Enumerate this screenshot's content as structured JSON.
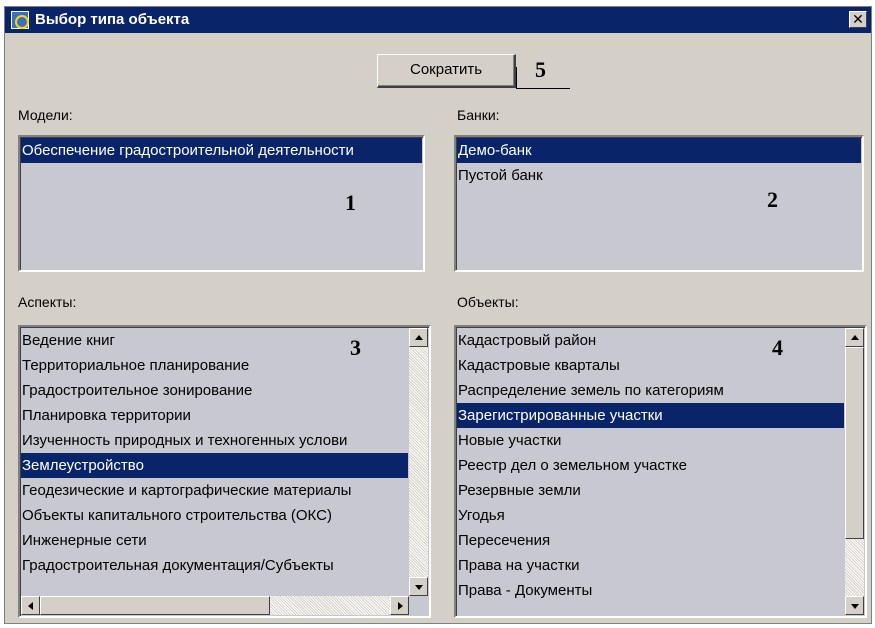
{
  "window": {
    "title": "Выбор типа объекта",
    "close_label": "✕"
  },
  "toolbar": {
    "shrink_label": "Сократить"
  },
  "callouts": {
    "c1": "1",
    "c2": "2",
    "c3": "3",
    "c4": "4",
    "c5": "5"
  },
  "models": {
    "label": "Модели:",
    "items": [
      {
        "label": "Обеспечение градостроительной деятельности",
        "selected": true
      }
    ]
  },
  "banks": {
    "label": "Банки:",
    "items": [
      {
        "label": "Демо-банк",
        "selected": true
      },
      {
        "label": "Пустой банк",
        "selected": false
      }
    ]
  },
  "aspects": {
    "label": "Аспекты:",
    "items": [
      {
        "label": "Ведение книг",
        "selected": false
      },
      {
        "label": "Территориальное планирование",
        "selected": false
      },
      {
        "label": "Градостроительное зонирование",
        "selected": false
      },
      {
        "label": "Планировка территории",
        "selected": false
      },
      {
        "label": "Изученность природных и техногенных услови",
        "selected": false
      },
      {
        "label": "Землеустройство",
        "selected": true
      },
      {
        "label": "Геодезические и картографические материалы",
        "selected": false
      },
      {
        "label": "Объекты капитального строительства (ОКС)",
        "selected": false
      },
      {
        "label": "Инженерные сети",
        "selected": false
      },
      {
        "label": "Градостроительная документация/Субъекты",
        "selected": false
      }
    ]
  },
  "objects": {
    "label": "Объекты:",
    "items": [
      {
        "label": "Кадастровый район",
        "selected": false
      },
      {
        "label": "Кадастровые кварталы",
        "selected": false
      },
      {
        "label": "Распределение земель по категориям",
        "selected": false
      },
      {
        "label": "Зарегистрированные участки",
        "selected": true
      },
      {
        "label": "Новые участки",
        "selected": false
      },
      {
        "label": "Реестр дел о земельном участке",
        "selected": false
      },
      {
        "label": "Резервные земли",
        "selected": false
      },
      {
        "label": "Угодья",
        "selected": false
      },
      {
        "label": "Пересечения",
        "selected": false
      },
      {
        "label": "Права на участки",
        "selected": false
      },
      {
        "label": "Права - Документы",
        "selected": false
      }
    ]
  },
  "icons": {
    "app": "app-window-icon",
    "close": "close-icon"
  },
  "colors": {
    "titlebar": "#0a246a",
    "selection": "#0a246a",
    "window_bg": "#d4d0c8",
    "list_bg": "#c8c8d0"
  }
}
